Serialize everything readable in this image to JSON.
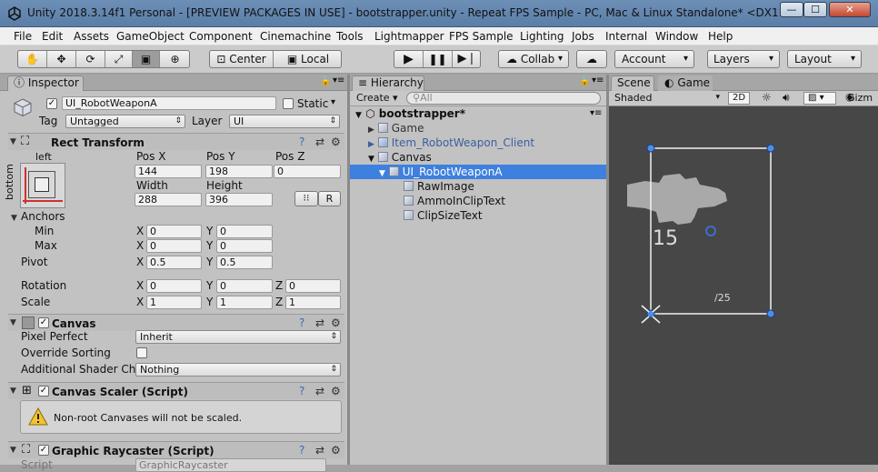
{
  "window": {
    "title": "Unity 2018.3.14f1 Personal - [PREVIEW PACKAGES IN USE] - bootstrapper.unity - Repeat FPS Sample - PC, Mac & Linux Standalone* <DX11>",
    "min": "—",
    "max": "☐",
    "close": "✕"
  },
  "menu": [
    "File",
    "Edit",
    "Assets",
    "GameObject",
    "Component",
    "Cinemachine",
    "Tools",
    "Lightmapper",
    "FPS Sample",
    "Lighting",
    "Jobs",
    "Internal",
    "Window",
    "Help"
  ],
  "toolbar": {
    "pivot_center": "Center",
    "pivot_local": "Local",
    "collab": "Collab",
    "account": "Account",
    "layers": "Layers",
    "layout": "Layout"
  },
  "inspector": {
    "tab": "Inspector",
    "object_name": "UI_RobotWeaponA",
    "static_label": "Static",
    "tag_label": "Tag",
    "tag_value": "Untagged",
    "layer_label": "Layer",
    "layer_value": "UI",
    "rect_transform": {
      "title": "Rect Transform",
      "anchor_top": "left",
      "anchor_side": "bottom",
      "posx_label": "Pos X",
      "posx": "144",
      "posy_label": "Pos Y",
      "posy": "198",
      "posz_label": "Pos Z",
      "posz": "0",
      "width_label": "Width",
      "width": "288",
      "height_label": "Height",
      "height": "396",
      "r_button": "R",
      "anchors_label": "Anchors",
      "min_label": "Min",
      "min_x": "0",
      "min_y": "0",
      "max_label": "Max",
      "max_x": "0",
      "max_y": "0",
      "pivot_label": "Pivot",
      "pivot_x": "0.5",
      "pivot_y": "0.5",
      "rotation_label": "Rotation",
      "rot_x": "0",
      "rot_y": "0",
      "rot_z": "0",
      "scale_label": "Scale",
      "scale_x": "1",
      "scale_y": "1",
      "scale_z": "1",
      "x": "X",
      "y": "Y",
      "z": "Z"
    },
    "canvas": {
      "title": "Canvas",
      "pixel_perfect_label": "Pixel Perfect",
      "pixel_perfect_value": "Inherit",
      "override_sorting_label": "Override Sorting",
      "shader_label": "Additional Shader Cha",
      "shader_value": "Nothing"
    },
    "canvas_scaler": {
      "title": "Canvas Scaler (Script)",
      "warning": "Non-root Canvases will not be scaled."
    },
    "graphic_raycaster": {
      "title": "Graphic Raycaster (Script)",
      "script_label": "Script",
      "script_value": "GraphicRaycaster"
    }
  },
  "hierarchy": {
    "tab": "Hierarchy",
    "create": "Create",
    "search_placeholder": "All",
    "scene": "bootstrapper*",
    "items": [
      {
        "label": "Game"
      },
      {
        "label": "Item_RobotWeapon_Client"
      },
      {
        "label": "Canvas"
      },
      {
        "label": "UI_RobotWeaponA"
      },
      {
        "label": "RawImage"
      },
      {
        "label": "AmmoInClipText"
      },
      {
        "label": "ClipSizeText"
      }
    ]
  },
  "scene_view": {
    "tab_scene": "Scene",
    "tab_game": "Game",
    "shading": "Shaded",
    "mode_2d": "2D",
    "gizmos": "Gizm",
    "ammo_text": "15",
    "clip_text": "/25"
  }
}
